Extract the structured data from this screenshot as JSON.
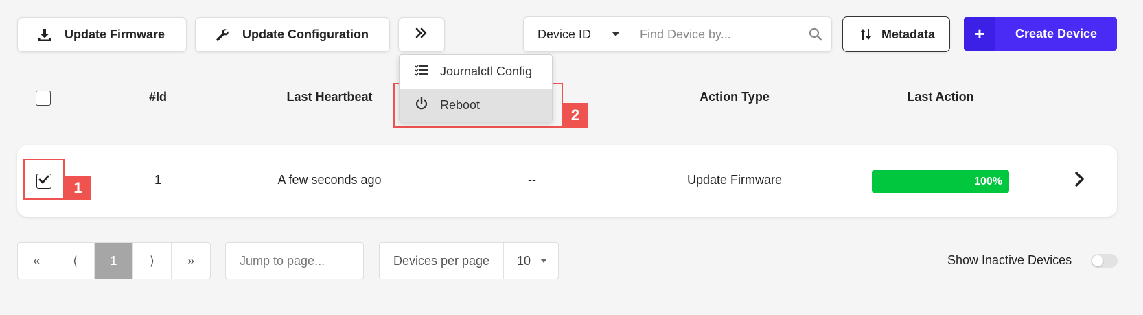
{
  "toolbar": {
    "update_firmware_label": "Update Firmware",
    "update_configuration_label": "Update Configuration",
    "more_label": "»",
    "search_field_select": "Device ID",
    "search_placeholder": "Find Device by...",
    "metadata_label": "Metadata",
    "create_device_label": "Create Device"
  },
  "dropdown": {
    "items": [
      {
        "label": "Journalctl Config",
        "icon": "list-icon"
      },
      {
        "label": "Reboot",
        "icon": "power-icon"
      }
    ]
  },
  "table": {
    "headers": [
      "#Id",
      "Last Heartbeat",
      "Action Type",
      "Last Action"
    ],
    "rows": [
      {
        "selected": true,
        "id": "1",
        "last_heartbeat": "A few seconds ago",
        "status": "--",
        "action_type": "Update Firmware",
        "progress_percent": 100,
        "progress_label": "100%"
      }
    ]
  },
  "annotations": [
    {
      "label": "1",
      "color": "#ef5350"
    },
    {
      "label": "2",
      "color": "#ef5350"
    }
  ],
  "pagination": {
    "first": "«",
    "prev": "⟨",
    "current": "1",
    "next": "⟩",
    "last": "»",
    "jump_placeholder": "Jump to page...",
    "per_page_label": "Devices per page",
    "per_page_value": "10"
  },
  "filters": {
    "show_inactive_label": "Show Inactive Devices",
    "show_inactive": false
  },
  "colors": {
    "accent": "#4a2bf5",
    "progress": "#00c73e",
    "annotation": "#ef5350",
    "background": "#f5f5f5"
  }
}
